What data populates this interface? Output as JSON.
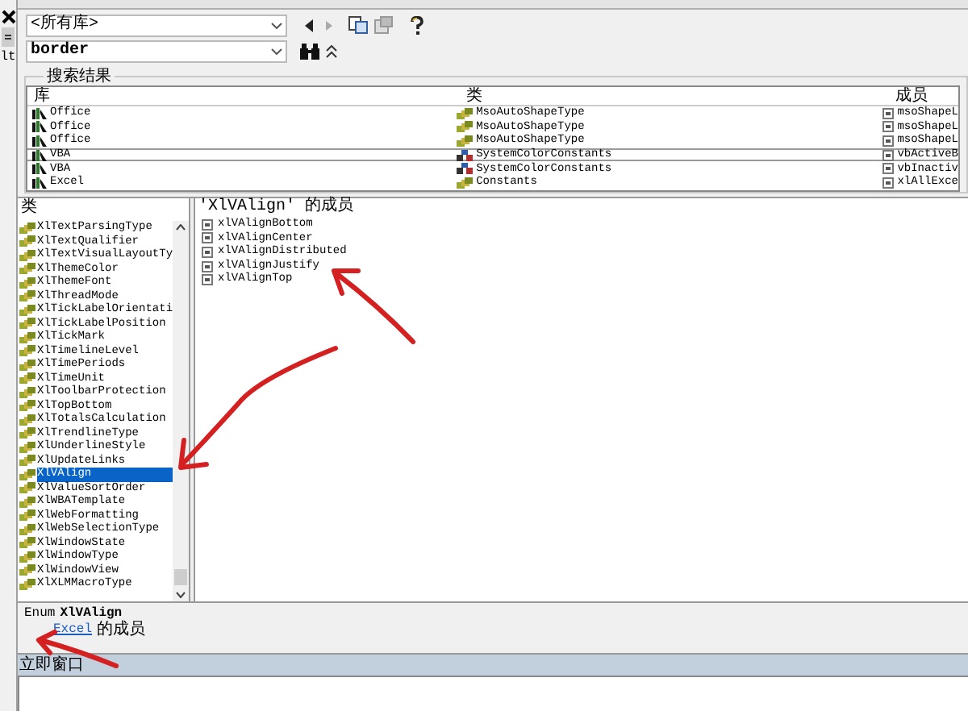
{
  "side_strip": {
    "label": "lt"
  },
  "library_combo": {
    "value": "<所有库>"
  },
  "search_combo": {
    "value": "border"
  },
  "search_results": {
    "title": "搜索结果",
    "columns": [
      "库",
      "类",
      "成员"
    ],
    "rows": [
      {
        "kind": "enum",
        "library": "Office",
        "class": "MsoAutoShapeType",
        "member": "msoShapeL",
        "selected": false
      },
      {
        "kind": "enum",
        "library": "Office",
        "class": "MsoAutoShapeType",
        "member": "msoShapeL",
        "selected": false
      },
      {
        "kind": "enum",
        "library": "Office",
        "class": "MsoAutoShapeType",
        "member": "msoShapeL",
        "selected": false
      },
      {
        "kind": "module",
        "library": "VBA",
        "class": "SystemColorConstants",
        "member": "vbActiveB",
        "selected": true
      },
      {
        "kind": "module",
        "library": "VBA",
        "class": "SystemColorConstants",
        "member": "vbInactiv",
        "selected": false
      },
      {
        "kind": "enum",
        "library": "Excel",
        "class": "Constants",
        "member": "xlAllExce",
        "selected": false
      }
    ]
  },
  "classes": {
    "title": "类",
    "items": [
      {
        "name": "XlTextParsingType",
        "selected": false
      },
      {
        "name": "XlTextQualifier",
        "selected": false
      },
      {
        "name": "XlTextVisualLayoutTy",
        "selected": false
      },
      {
        "name": "XlThemeColor",
        "selected": false
      },
      {
        "name": "XlThemeFont",
        "selected": false
      },
      {
        "name": "XlThreadMode",
        "selected": false
      },
      {
        "name": "XlTickLabelOrientati",
        "selected": false
      },
      {
        "name": "XlTickLabelPosition",
        "selected": false
      },
      {
        "name": "XlTickMark",
        "selected": false
      },
      {
        "name": "XlTimelineLevel",
        "selected": false
      },
      {
        "name": "XlTimePeriods",
        "selected": false
      },
      {
        "name": "XlTimeUnit",
        "selected": false
      },
      {
        "name": "XlToolbarProtection",
        "selected": false
      },
      {
        "name": "XlTopBottom",
        "selected": false
      },
      {
        "name": "XlTotalsCalculation",
        "selected": false
      },
      {
        "name": "XlTrendlineType",
        "selected": false
      },
      {
        "name": "XlUnderlineStyle",
        "selected": false
      },
      {
        "name": "XlUpdateLinks",
        "selected": false
      },
      {
        "name": "XlVAlign",
        "selected": true
      },
      {
        "name": "XlValueSortOrder",
        "selected": false
      },
      {
        "name": "XlWBATemplate",
        "selected": false
      },
      {
        "name": "XlWebFormatting",
        "selected": false
      },
      {
        "name": "XlWebSelectionType",
        "selected": false
      },
      {
        "name": "XlWindowState",
        "selected": false
      },
      {
        "name": "XlWindowType",
        "selected": false
      },
      {
        "name": "XlWindowView",
        "selected": false
      },
      {
        "name": "XlXLMMacroType",
        "selected": false
      }
    ]
  },
  "members": {
    "title": "'XlVAlign' 的成员",
    "items": [
      "xlVAlignBottom",
      "xlVAlignCenter",
      "xlVAlignDistributed",
      "xlVAlignJustify",
      "xlVAlignTop"
    ]
  },
  "details": {
    "keyword": "Enum",
    "name": "XlVAlign",
    "library_link": "Excel",
    "library_suffix": "的成员"
  },
  "immediate_window": {
    "title": "立即窗口"
  }
}
